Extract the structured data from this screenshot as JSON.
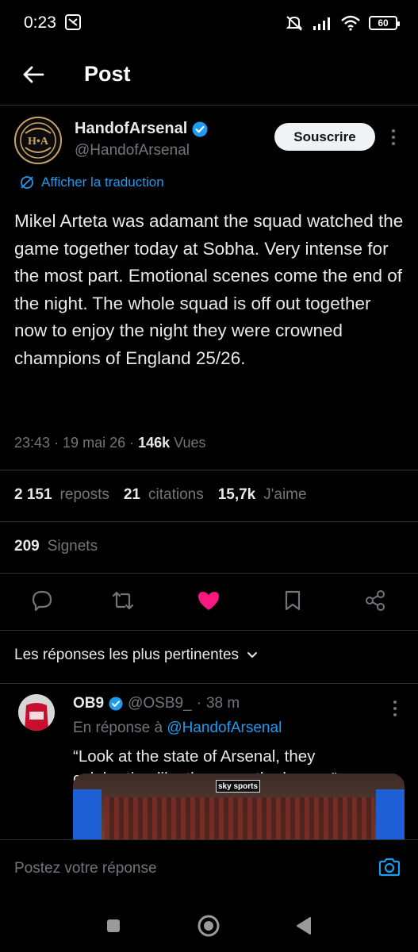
{
  "status_bar": {
    "time": "0:23",
    "battery": "60"
  },
  "header": {
    "title": "Post"
  },
  "post": {
    "author_name": "HandofArsenal",
    "author_handle": "@HandofArsenal",
    "subscribe_label": "Souscrire",
    "avatar_text": "H•A",
    "translate_label": "Afficher la traduction",
    "text": "Mikel Arteta was adamant the squad watched the game together today at Sobha. Very intense for the most part. Emotional scenes come the end of the night. The whole squad is off out together now to enjoy the night they were crowned champions of England 25/26.",
    "time": "23:43",
    "date": "19 mai 26",
    "views_count": "146k",
    "views_label": "Vues",
    "reposts_count": "2 151",
    "reposts_label": "reposts",
    "quotes_count": "21",
    "quotes_label": "citations",
    "likes_count": "15,7k",
    "likes_label": "J'aime",
    "bookmarks_count": "209",
    "bookmarks_label": "Signets"
  },
  "sort": {
    "label": "Les réponses les plus pertinentes"
  },
  "reply": {
    "name": "OB9",
    "handle": "@OSB9_",
    "age": "38 m",
    "replying_prefix": "En réponse à",
    "replying_to": "@HandofArsenal",
    "text": "“Look at the state of Arsenal, they celebrating like they won the league”",
    "media_logo": "sky sports"
  },
  "compose": {
    "placeholder": "Postez votre réponse"
  },
  "colors": {
    "accent": "#1d9bf0",
    "like": "#f91880",
    "background": "#000000"
  }
}
